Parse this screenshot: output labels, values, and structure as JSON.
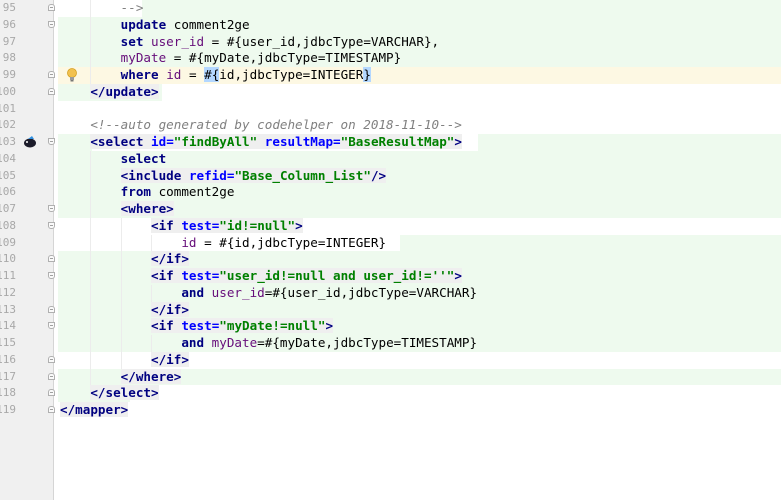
{
  "editor": {
    "language": "xml",
    "colors": {
      "changed_line_bg": "#eefaee",
      "caret_line_bg": "#fdf8e3",
      "gutter_bg": "#f0f0f0",
      "tag": "#000080",
      "attribute": "#0000ff",
      "string": "#008000",
      "comment": "#808080",
      "field": "#660e7a",
      "brace_match": "#b3d7ff"
    },
    "lines": [
      {
        "num": "95",
        "text": "        -->"
      },
      {
        "num": "96",
        "text": "        update comment2ge"
      },
      {
        "num": "97",
        "text": "        set user_id = #{user_id,jdbcType=VARCHAR},"
      },
      {
        "num": "98",
        "text": "        myDate = #{myDate,jdbcType=TIMESTAMP}"
      },
      {
        "num": "99",
        "text": "        where id = #{id,jdbcType=INTEGER}"
      },
      {
        "num": "100",
        "text": "    </update>"
      },
      {
        "num": "101",
        "text": ""
      },
      {
        "num": "102",
        "text": "    <!--auto generated by codehelper on 2018-11-10-->"
      },
      {
        "num": "103",
        "text": "    <select id=\"findByAll\" resultMap=\"BaseResultMap\">"
      },
      {
        "num": "104",
        "text": "        select"
      },
      {
        "num": "105",
        "text": "        <include refid=\"Base_Column_List\"/>"
      },
      {
        "num": "106",
        "text": "        from comment2ge"
      },
      {
        "num": "107",
        "text": "        <where>"
      },
      {
        "num": "108",
        "text": "            <if test=\"id!=null\">"
      },
      {
        "num": "109",
        "text": "                id = #{id,jdbcType=INTEGER}"
      },
      {
        "num": "110",
        "text": "            </if>"
      },
      {
        "num": "111",
        "text": "            <if test=\"user_id!=null and user_id!=''\">"
      },
      {
        "num": "112",
        "text": "                and user_id=#{user_id,jdbcType=VARCHAR}"
      },
      {
        "num": "113",
        "text": "            </if>"
      },
      {
        "num": "114",
        "text": "            <if test=\"myDate!=null\">"
      },
      {
        "num": "115",
        "text": "                and myDate=#{myDate,jdbcType=TIMESTAMP}"
      },
      {
        "num": "116",
        "text": "            </if>"
      },
      {
        "num": "117",
        "text": "        </where>"
      },
      {
        "num": "118",
        "text": "    </select>"
      },
      {
        "num": "119",
        "text": "</mapper>"
      }
    ],
    "tokens": {
      "l95": [
        "        ",
        "-->"
      ],
      "l96": [
        "        ",
        "update",
        " comment2ge"
      ],
      "l97": [
        "        ",
        "set",
        " ",
        "user_id",
        " = #{user_id,jdbcType=VARCHAR},"
      ],
      "l98": [
        "        ",
        "myDate",
        " = #{myDate,jdbcType=TIMESTAMP}"
      ],
      "l99": [
        "        ",
        "where",
        " ",
        "id",
        " = ",
        "#{",
        "id,jdbcType=INTEGER",
        "}"
      ],
      "l100": [
        "    ",
        "</update>"
      ],
      "l102": [
        "    ",
        "<!--auto generated by codehelper on 2018-11-10-->"
      ],
      "l103": [
        "    ",
        "<select",
        " ",
        "id",
        "=",
        "\"findByAll\"",
        " ",
        "resultMap",
        "=",
        "\"BaseResultMap\"",
        ">"
      ],
      "l104": [
        "        ",
        "select"
      ],
      "l105": [
        "        ",
        "<include",
        " ",
        "refid",
        "=",
        "\"Base_Column_List\"",
        "/>"
      ],
      "l106": [
        "        ",
        "from",
        " comment2ge"
      ],
      "l107": [
        "        ",
        "<where>"
      ],
      "l108": [
        "            ",
        "<if",
        " ",
        "test",
        "=",
        "\"id!=null\"",
        ">"
      ],
      "l109": [
        "                ",
        "id",
        " = #{id,jdbcType=INTEGER}"
      ],
      "l110": [
        "            ",
        "</if>"
      ],
      "l111": [
        "            ",
        "<if",
        " ",
        "test",
        "=",
        "\"user_id!=null and user_id!=''\"",
        ">"
      ],
      "l112": [
        "                ",
        "and",
        " ",
        "user_id",
        "=#{user_id,jdbcType=VARCHAR}"
      ],
      "l113": [
        "            ",
        "</if>"
      ],
      "l114": [
        "            ",
        "<if",
        " ",
        "test",
        "=",
        "\"myDate!=null\"",
        ">"
      ],
      "l115": [
        "                ",
        "and",
        " ",
        "myDate",
        "=#{myDate,jdbcType=TIMESTAMP}"
      ],
      "l116": [
        "            ",
        "</if>"
      ],
      "l117": [
        "        ",
        "</where>"
      ],
      "l118": [
        "    ",
        "</select>"
      ],
      "l119": [
        "",
        "</mapper>"
      ]
    },
    "gutter_icons": {
      "bulb_line": "99",
      "bird_line": "103"
    }
  }
}
